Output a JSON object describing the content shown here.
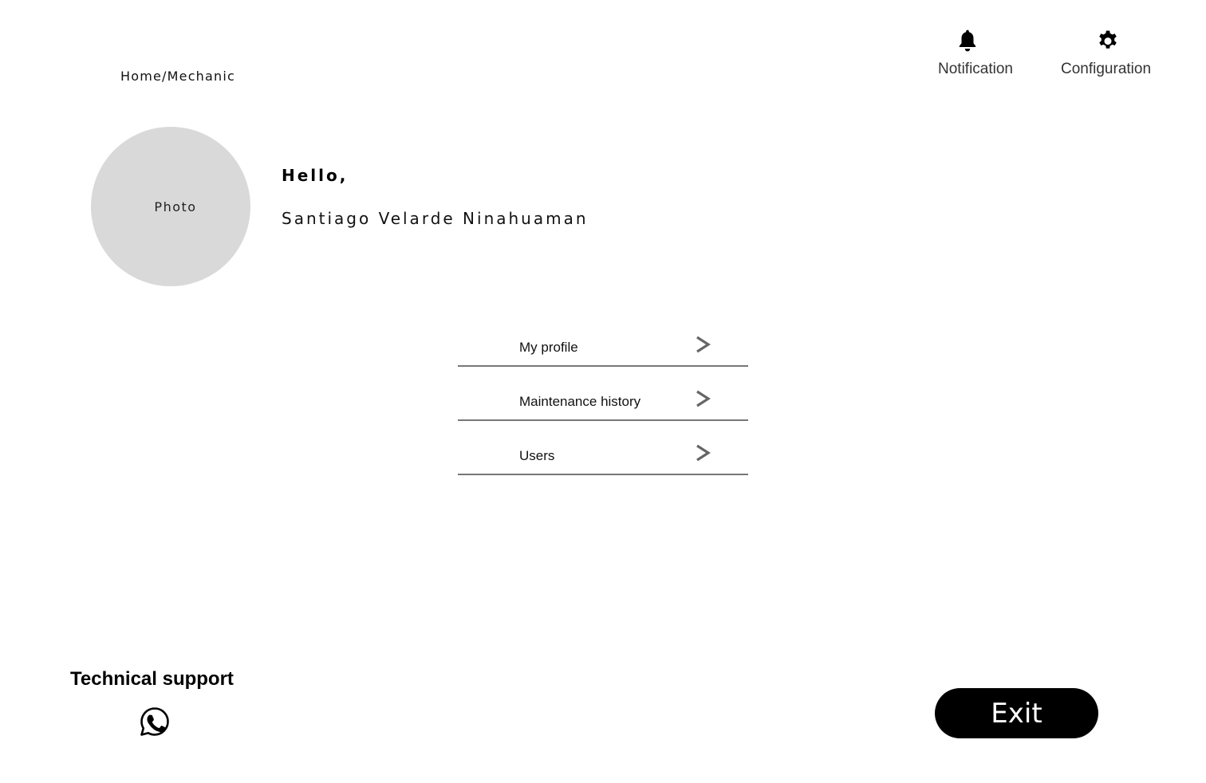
{
  "breadcrumb": "Home/Mechanic",
  "header": {
    "notification_label": "Notification",
    "configuration_label": "Configuration",
    "notification_icon": "bell-icon",
    "configuration_icon": "gear-icon"
  },
  "profile": {
    "photo_label": "Photo",
    "greeting": "Hello,",
    "name": "Santiago Velarde Ninahuaman"
  },
  "menu": {
    "items": [
      {
        "label": "My profile"
      },
      {
        "label": "Maintenance history"
      },
      {
        "label": "Users"
      }
    ],
    "chevron_icon": "chevron-right-icon"
  },
  "support": {
    "title": "Technical support",
    "icon": "whatsapp-icon"
  },
  "exit_label": "Exit",
  "colors": {
    "avatar_bg": "#d9d9d9",
    "divider": "#777777",
    "chevron": "#666666",
    "exit_bg": "#000000",
    "exit_text": "#ffffff"
  }
}
